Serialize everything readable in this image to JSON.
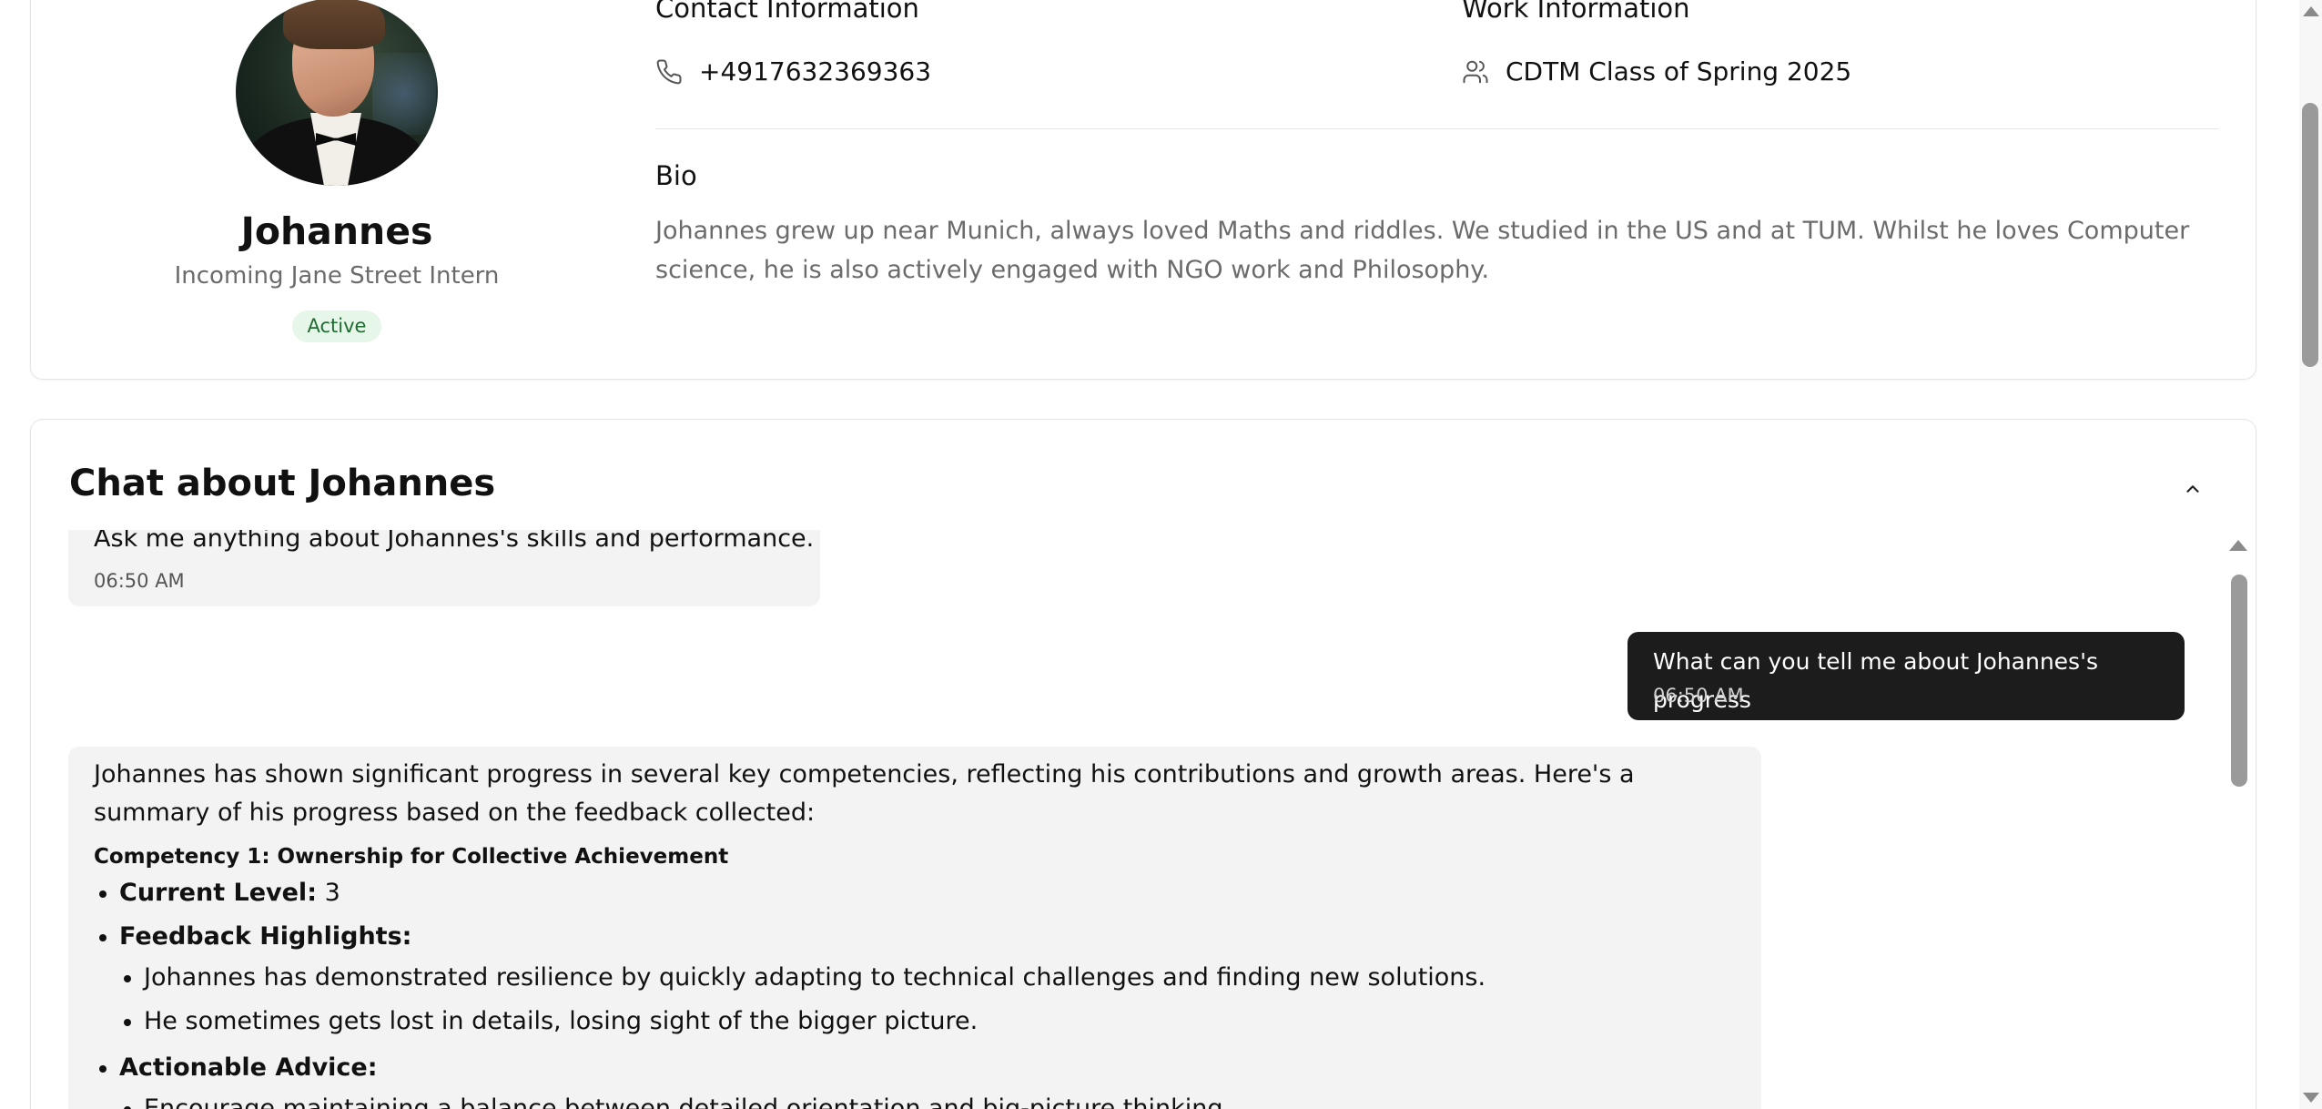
{
  "profile": {
    "name": "Johannes",
    "role": "Incoming Jane Street Intern",
    "status": "Active",
    "contact_heading": "Contact Information",
    "phone": "+4917632369363",
    "work_heading": "Work Information",
    "work_group": "CDTM Class of Spring 2025",
    "bio_heading": "Bio",
    "bio": "Johannes grew up near Munich, always loved Maths and riddles. We studied in the US and at TUM. Whilst he loves Computer science, he is also actively engaged with NGO work and Philosophy."
  },
  "chat": {
    "title": "Chat about Johannes",
    "messages": [
      {
        "sender": "assistant",
        "text": "Ask me anything about Johannes's skills and performance.",
        "time": "06:50 AM"
      },
      {
        "sender": "user",
        "text": "What can you tell me about Johannes's progress",
        "time": "06:50 AM"
      },
      {
        "sender": "assistant",
        "intro": "Johannes has shown significant progress in several key competencies, reflecting his contributions and growth areas. Here's a summary of his progress based on the feedback collected:",
        "competency_heading": "Competency 1: Ownership for Collective Achievement",
        "current_level_label": "Current Level:",
        "current_level_value": "3",
        "feedback_label": "Feedback Highlights:",
        "feedback": [
          "Johannes has demonstrated resilience by quickly adapting to technical challenges and finding new solutions.",
          "He sometimes gets lost in details, losing sight of the bigger picture."
        ],
        "advice_label": "Actionable Advice:",
        "advice": [
          "Encourage maintaining a balance between detailed orientation and big-picture thinking."
        ]
      }
    ]
  },
  "icons": {
    "phone": "phone-icon",
    "users": "users-icon",
    "collapse": "chevron-up-icon"
  },
  "colors": {
    "status_bg": "#e6f6e8",
    "status_text": "#1f6b32",
    "user_bubble": "#1c1c1c",
    "assistant_bubble": "#f3f3f3",
    "muted_text": "#6b6b6b"
  }
}
